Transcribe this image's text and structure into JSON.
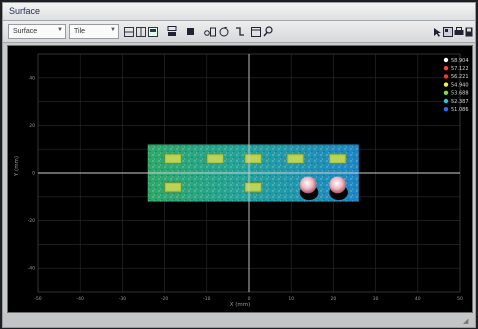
{
  "window": {
    "title": "Surface"
  },
  "toolbar": {
    "view_select": "Surface",
    "mode_select": "Tile"
  },
  "icons": {
    "toolbar": [
      "layers-icon",
      "grid-icon",
      "layout-icon",
      "stack-icon",
      "crop-icon",
      "zoom-icon",
      "rotate-icon",
      "tilt-icon",
      "frame-icon",
      "search-icon"
    ],
    "right": [
      "pointer-icon",
      "palette-icon",
      "print-icon",
      "save-icon"
    ]
  },
  "plot": {
    "x_axis_label": "X (mm)",
    "y_axis_label": "Y (mm)",
    "x_ticks": [
      "-50",
      "-40",
      "-30",
      "-20",
      "-10",
      "0",
      "10",
      "20",
      "30",
      "40",
      "50"
    ],
    "y_ticks": [
      "40",
      "20",
      "0",
      "-20",
      "-40"
    ],
    "colors": {
      "grid": "#2c2c2c",
      "axis": "#cfcfcf",
      "tick_text": "#9a9a9a"
    }
  },
  "legend": {
    "entries": [
      {
        "value": "58.904",
        "color": "#ffffff"
      },
      {
        "value": "57.122",
        "color": "#ff4040"
      },
      {
        "value": "56.221",
        "color": "#ff3030"
      },
      {
        "value": "54.940",
        "color": "#f2f24a"
      },
      {
        "value": "53.688",
        "color": "#74e04a"
      },
      {
        "value": "52.387",
        "color": "#28c8d8"
      },
      {
        "value": "51.086",
        "color": "#2a6ef0"
      }
    ]
  },
  "chart_data": {
    "type": "heatmap",
    "xlabel": "X (mm)",
    "ylabel": "Y (mm)",
    "xlim": [
      -50,
      50
    ],
    "ylim": [
      -50,
      50
    ],
    "grid": true,
    "legend_position": "top-right",
    "surface": {
      "x_range": [
        -24,
        26
      ],
      "y_range": [
        -12,
        12
      ]
    },
    "features": [
      {
        "kind": "pad",
        "x": [
          -20,
          -16
        ],
        "y": [
          4,
          8
        ]
      },
      {
        "kind": "pad",
        "x": [
          -10,
          -6
        ],
        "y": [
          4,
          8
        ]
      },
      {
        "kind": "pad",
        "x": [
          -1,
          3
        ],
        "y": [
          4,
          8
        ]
      },
      {
        "kind": "pad",
        "x": [
          9,
          13
        ],
        "y": [
          4,
          8
        ]
      },
      {
        "kind": "pad",
        "x": [
          19,
          23
        ],
        "y": [
          4,
          8
        ]
      },
      {
        "kind": "pad",
        "x": [
          -20,
          -16
        ],
        "y": [
          -8,
          -4
        ]
      },
      {
        "kind": "pad",
        "x": [
          -1,
          3
        ],
        "y": [
          -8,
          -4
        ]
      },
      {
        "kind": "peak",
        "x": [
          12,
          16
        ],
        "y": [
          -7,
          -3
        ]
      },
      {
        "kind": "peak",
        "x": [
          19,
          23
        ],
        "y": [
          -7,
          -3
        ]
      }
    ]
  }
}
